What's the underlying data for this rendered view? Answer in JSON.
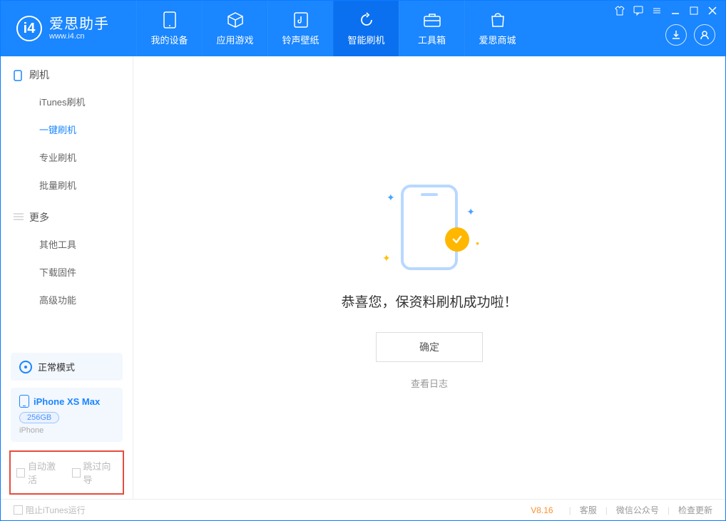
{
  "logo": {
    "cn": "爱思助手",
    "url": "www.i4.cn",
    "glyph": "i4"
  },
  "nav": [
    {
      "label": "我的设备",
      "icon": "device-icon"
    },
    {
      "label": "应用游戏",
      "icon": "cube-icon"
    },
    {
      "label": "铃声壁纸",
      "icon": "music-icon"
    },
    {
      "label": "智能刷机",
      "icon": "sync-icon",
      "active": true
    },
    {
      "label": "工具箱",
      "icon": "toolbox-icon"
    },
    {
      "label": "爱思商城",
      "icon": "bag-icon"
    }
  ],
  "sidebar": {
    "section1": {
      "title": "刷机",
      "items": [
        "iTunes刷机",
        "一键刷机",
        "专业刷机",
        "批量刷机"
      ],
      "activeIndex": 1
    },
    "section2": {
      "title": "更多",
      "items": [
        "其他工具",
        "下载固件",
        "高级功能"
      ]
    }
  },
  "mode": {
    "label": "正常模式"
  },
  "device": {
    "name": "iPhone XS Max",
    "capacity": "256GB",
    "sub": "iPhone"
  },
  "options": {
    "auto_activate": "自动激活",
    "skip_guide": "跳过向导"
  },
  "main": {
    "message": "恭喜您，保资料刷机成功啦！",
    "ok": "确定",
    "view_log": "查看日志"
  },
  "footer": {
    "block_itunes": "阻止iTunes运行",
    "version": "V8.16",
    "links": [
      "客服",
      "微信公众号",
      "检查更新"
    ]
  }
}
